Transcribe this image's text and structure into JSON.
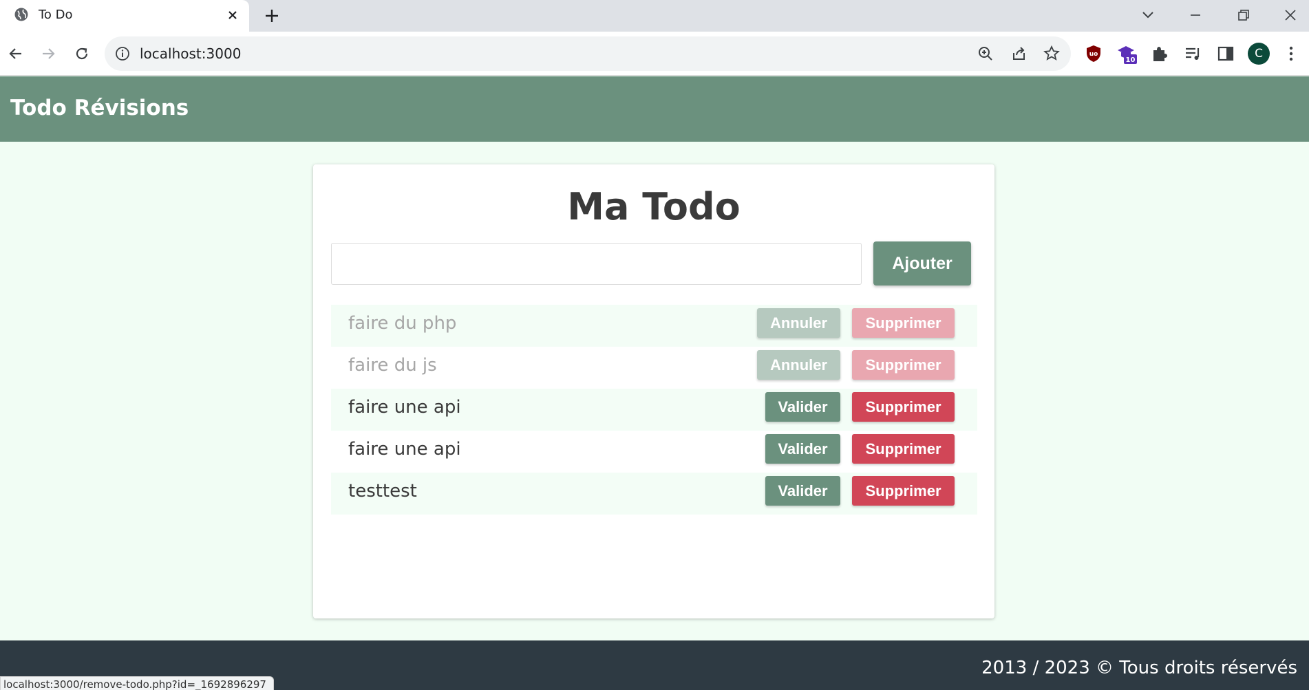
{
  "browser": {
    "tab_title": "To Do",
    "url": "localhost:3000",
    "profile_initial": "C",
    "extension_badge": "10",
    "status_url": "localhost:3000/remove-todo.php?id=_1692896297"
  },
  "header": {
    "site_title": "Todo Révisions"
  },
  "card": {
    "title": "Ma Todo",
    "input_value": "",
    "add_label": "Ajouter"
  },
  "todos": [
    {
      "text": "faire du php",
      "done": true,
      "action_label": "Annuler",
      "delete_label": "Supprimer"
    },
    {
      "text": "faire du js",
      "done": true,
      "action_label": "Annuler",
      "delete_label": "Supprimer"
    },
    {
      "text": "faire une api",
      "done": false,
      "action_label": "Valider",
      "delete_label": "Supprimer"
    },
    {
      "text": "faire une api",
      "done": false,
      "action_label": "Valider",
      "delete_label": "Supprimer"
    },
    {
      "text": "testtest",
      "done": false,
      "action_label": "Valider",
      "delete_label": "Supprimer"
    }
  ],
  "footer": {
    "text": "2013 / 2023 © Tous droits réservés"
  },
  "colors": {
    "primary": "#6b917e",
    "danger": "#d14657",
    "page_bg": "#f1fdf4",
    "footer_bg": "#2e3a43"
  }
}
